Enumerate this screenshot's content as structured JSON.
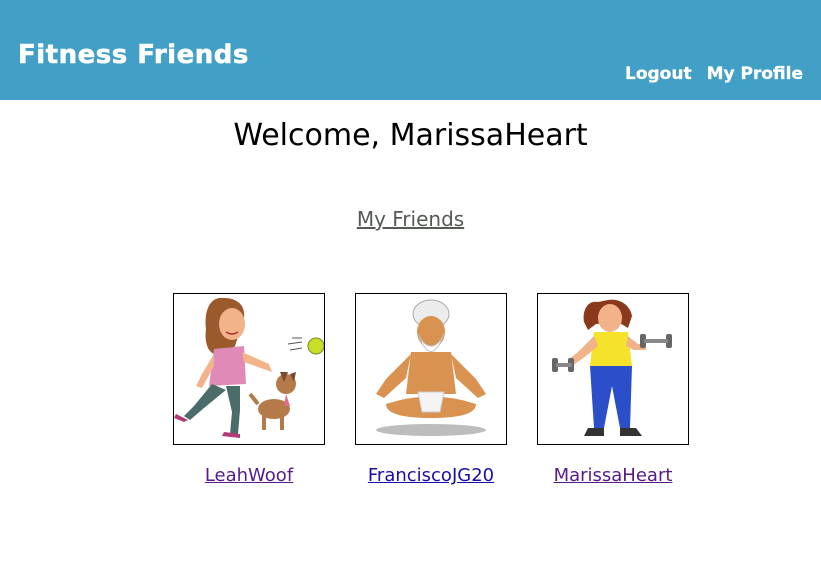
{
  "header": {
    "brand": "Fitness Friends",
    "nav": {
      "logout": "Logout",
      "profile": "My Profile"
    }
  },
  "main": {
    "welcome": "Welcome, MarissaHeart",
    "section_title": "My Friends",
    "friends": [
      {
        "username": "LeahWoof",
        "avatar": "woman-playing-with-dog"
      },
      {
        "username": "FranciscoJG20",
        "avatar": "man-meditating"
      },
      {
        "username": "MarissaHeart",
        "avatar": "woman-lifting-dumbbells"
      }
    ]
  },
  "colors": {
    "navbar": "#429fc5",
    "link": "#1a0dab",
    "visited_link": "#551a8b"
  }
}
